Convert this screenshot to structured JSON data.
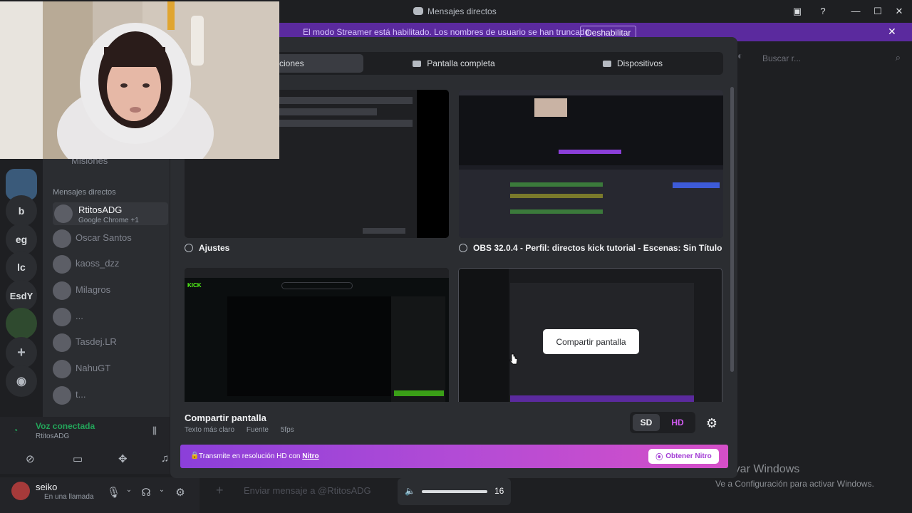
{
  "window": {
    "title": "Mensajes directos"
  },
  "banner": {
    "message": "El modo Streamer está habilitado. Los nombres de usuario se han truncado.",
    "button": "Deshabilitar"
  },
  "servers": [
    "b",
    "eg",
    "lc",
    "EsdY"
  ],
  "sidebar": {
    "missions_label": "Misiones",
    "dm_header": "Mensajes directos",
    "dms": [
      {
        "name": "RtitosADG",
        "sub": "Google Chrome +1"
      },
      {
        "name": "Oscar Santos"
      },
      {
        "name": "kaoss_dzz"
      },
      {
        "name": "Milagros"
      },
      {
        "name": "..."
      },
      {
        "name": "Tasdej.LR"
      },
      {
        "name": "NahuGT"
      },
      {
        "name": "t..."
      }
    ]
  },
  "voice": {
    "status": "Voz conectada",
    "channel": "RtitosADG"
  },
  "user": {
    "name": "seiko",
    "status": "En una llamada"
  },
  "chat": {
    "placeholder": "Enviar mensaje a @RtitosADG"
  },
  "search": {
    "placeholder": "Buscar r..."
  },
  "modal": {
    "tabs": [
      {
        "label": "Aplicaciones",
        "visible_label": "aciones"
      },
      {
        "label": "Pantalla completa"
      },
      {
        "label": "Dispositivos"
      }
    ],
    "sources": [
      {
        "caption": "Ajustes"
      },
      {
        "caption": "OBS 32.0.4 - Perfil: directos kick tutorial - Escenas: Sin Título"
      },
      {
        "caption": ""
      },
      {
        "caption": ""
      }
    ],
    "share_button": "Compartir pantalla",
    "footer_title": "Compartir pantalla",
    "footer_options": [
      "Texto más claro",
      "Fuente",
      "5fps"
    ],
    "quality": {
      "sd": "SD",
      "hd": "HD",
      "selected": "SD"
    },
    "nitro": {
      "text": "Transmite en resolución HD con",
      "link": "Nitro",
      "button": "Obtener Nitro"
    }
  },
  "volume": {
    "value": "16",
    "level": 0.16
  },
  "watermark": {
    "line1": "Activar Windows",
    "line2": "Ve a Configuración para activar Windows."
  },
  "colors": {
    "accent": "#5865f2",
    "nitro": "#b24bd6",
    "online": "#23a55a"
  }
}
